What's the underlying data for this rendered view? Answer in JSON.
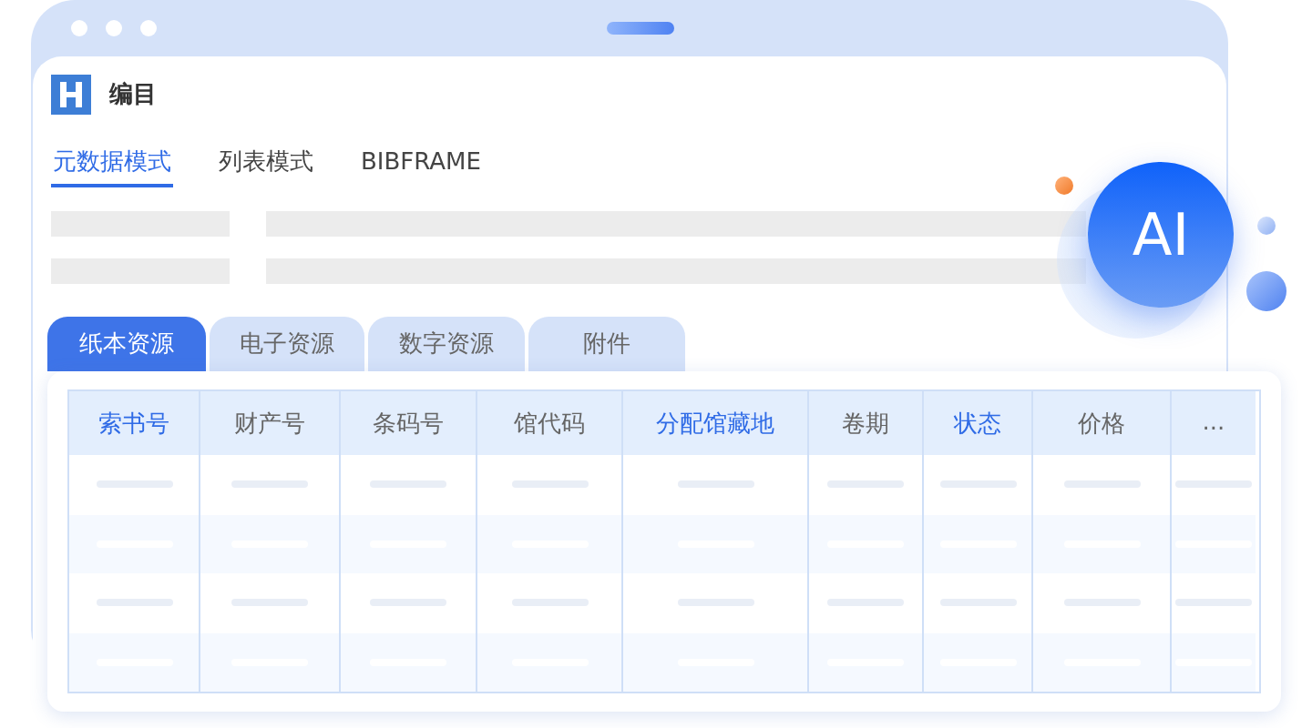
{
  "app": {
    "title": "编目"
  },
  "view_tabs": [
    {
      "label": "元数据模式",
      "selected": true
    },
    {
      "label": "列表模式",
      "selected": false
    },
    {
      "label": "BIBFRAME",
      "selected": false
    }
  ],
  "resource_tabs": [
    {
      "label": "纸本资源",
      "selected": true
    },
    {
      "label": "电子资源",
      "selected": false
    },
    {
      "label": "数字资源",
      "selected": false
    },
    {
      "label": "附件",
      "selected": false
    }
  ],
  "table": {
    "columns": [
      {
        "label": "索书号",
        "highlighted": true
      },
      {
        "label": "财产号",
        "highlighted": false
      },
      {
        "label": "条码号",
        "highlighted": false
      },
      {
        "label": "馆代码",
        "highlighted": false
      },
      {
        "label": "分配馆藏地",
        "highlighted": true
      },
      {
        "label": "卷期",
        "highlighted": false
      },
      {
        "label": "状态",
        "highlighted": true
      },
      {
        "label": "价格",
        "highlighted": false
      },
      {
        "label": "...",
        "highlighted": false
      }
    ]
  },
  "ai_badge": {
    "label": "AI"
  }
}
